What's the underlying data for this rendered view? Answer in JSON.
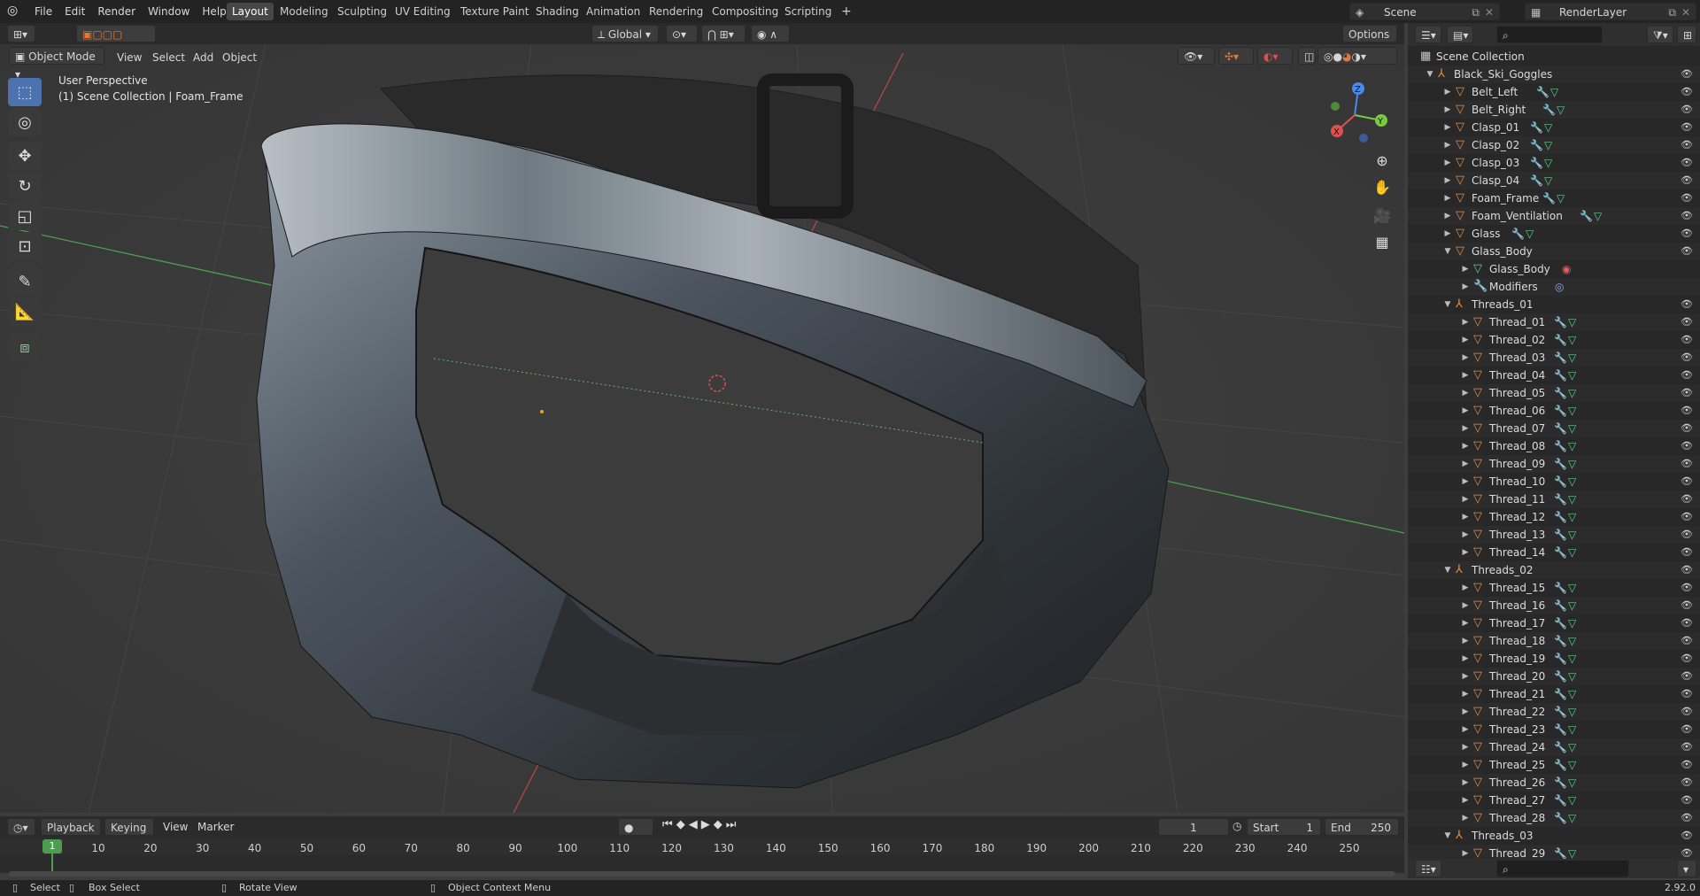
{
  "topbar": {
    "menus": [
      "File",
      "Edit",
      "Render",
      "Window",
      "Help"
    ],
    "tabs": [
      "Layout",
      "Modeling",
      "Sculpting",
      "UV Editing",
      "Texture Paint",
      "Shading",
      "Animation",
      "Rendering",
      "Compositing",
      "Scripting"
    ],
    "add_tab": "+",
    "scene_label": "Scene",
    "renderlayer_label": "RenderLayer"
  },
  "viewport_header": {
    "mode": "Object Mode",
    "menus": [
      "View",
      "Select",
      "Add",
      "Object"
    ],
    "transform": "Global",
    "options": "Options"
  },
  "viewport": {
    "perspective": "User Perspective",
    "context": "(1) Scene Collection | Foam_Frame",
    "gizmo_axes": [
      "X",
      "Y",
      "Z"
    ]
  },
  "outliner": {
    "search_placeholder": "",
    "rows": [
      {
        "label": "Scene Collection",
        "depth": 0,
        "type": "scene",
        "arrow": ""
      },
      {
        "label": "Black_Ski_Goggles",
        "depth": 1,
        "type": "empty",
        "arrow": "▼"
      },
      {
        "label": "Belt_Left",
        "depth": 2,
        "type": "mesh",
        "arrow": "▶",
        "mods": true
      },
      {
        "label": "Belt_Right",
        "depth": 2,
        "type": "mesh",
        "arrow": "▶",
        "mods": true
      },
      {
        "label": "Clasp_01",
        "depth": 2,
        "type": "mesh",
        "arrow": "▶",
        "mods": true
      },
      {
        "label": "Clasp_02",
        "depth": 2,
        "type": "mesh",
        "arrow": "▶",
        "mods": true
      },
      {
        "label": "Clasp_03",
        "depth": 2,
        "type": "mesh",
        "arrow": "▶",
        "mods": true
      },
      {
        "label": "Clasp_04",
        "depth": 2,
        "type": "mesh",
        "arrow": "▶",
        "mods": true
      },
      {
        "label": "Foam_Frame",
        "depth": 2,
        "type": "mesh",
        "arrow": "▶",
        "mods": true
      },
      {
        "label": "Foam_Ventilation",
        "depth": 2,
        "type": "mesh",
        "arrow": "▶",
        "mods": true
      },
      {
        "label": "Glass",
        "depth": 2,
        "type": "mesh",
        "arrow": "▶",
        "mods": true
      },
      {
        "label": "Glass_Body",
        "depth": 2,
        "type": "mesh",
        "arrow": "▼",
        "mods": false
      },
      {
        "label": "Glass_Body",
        "depth": 3,
        "type": "meshdata",
        "arrow": "▶",
        "mods": false,
        "material": true
      },
      {
        "label": "Modifiers",
        "depth": 3,
        "type": "modifier",
        "arrow": "▶",
        "mods": false,
        "modicon": true
      },
      {
        "label": "Threads_01",
        "depth": 2,
        "type": "empty",
        "arrow": "▼"
      },
      {
        "label": "Thread_01",
        "depth": 3,
        "type": "mesh",
        "arrow": "▶",
        "mods": true
      },
      {
        "label": "Thread_02",
        "depth": 3,
        "type": "mesh",
        "arrow": "▶",
        "mods": true
      },
      {
        "label": "Thread_03",
        "depth": 3,
        "type": "mesh",
        "arrow": "▶",
        "mods": true
      },
      {
        "label": "Thread_04",
        "depth": 3,
        "type": "mesh",
        "arrow": "▶",
        "mods": true
      },
      {
        "label": "Thread_05",
        "depth": 3,
        "type": "mesh",
        "arrow": "▶",
        "mods": true
      },
      {
        "label": "Thread_06",
        "depth": 3,
        "type": "mesh",
        "arrow": "▶",
        "mods": true
      },
      {
        "label": "Thread_07",
        "depth": 3,
        "type": "mesh",
        "arrow": "▶",
        "mods": true
      },
      {
        "label": "Thread_08",
        "depth": 3,
        "type": "mesh",
        "arrow": "▶",
        "mods": true
      },
      {
        "label": "Thread_09",
        "depth": 3,
        "type": "mesh",
        "arrow": "▶",
        "mods": true
      },
      {
        "label": "Thread_10",
        "depth": 3,
        "type": "mesh",
        "arrow": "▶",
        "mods": true
      },
      {
        "label": "Thread_11",
        "depth": 3,
        "type": "mesh",
        "arrow": "▶",
        "mods": true
      },
      {
        "label": "Thread_12",
        "depth": 3,
        "type": "mesh",
        "arrow": "▶",
        "mods": true
      },
      {
        "label": "Thread_13",
        "depth": 3,
        "type": "mesh",
        "arrow": "▶",
        "mods": true
      },
      {
        "label": "Thread_14",
        "depth": 3,
        "type": "mesh",
        "arrow": "▶",
        "mods": true
      },
      {
        "label": "Threads_02",
        "depth": 2,
        "type": "empty",
        "arrow": "▼"
      },
      {
        "label": "Thread_15",
        "depth": 3,
        "type": "mesh",
        "arrow": "▶",
        "mods": true
      },
      {
        "label": "Thread_16",
        "depth": 3,
        "type": "mesh",
        "arrow": "▶",
        "mods": true
      },
      {
        "label": "Thread_17",
        "depth": 3,
        "type": "mesh",
        "arrow": "▶",
        "mods": true
      },
      {
        "label": "Thread_18",
        "depth": 3,
        "type": "mesh",
        "arrow": "▶",
        "mods": true
      },
      {
        "label": "Thread_19",
        "depth": 3,
        "type": "mesh",
        "arrow": "▶",
        "mods": true
      },
      {
        "label": "Thread_20",
        "depth": 3,
        "type": "mesh",
        "arrow": "▶",
        "mods": true
      },
      {
        "label": "Thread_21",
        "depth": 3,
        "type": "mesh",
        "arrow": "▶",
        "mods": true
      },
      {
        "label": "Thread_22",
        "depth": 3,
        "type": "mesh",
        "arrow": "▶",
        "mods": true
      },
      {
        "label": "Thread_23",
        "depth": 3,
        "type": "mesh",
        "arrow": "▶",
        "mods": true
      },
      {
        "label": "Thread_24",
        "depth": 3,
        "type": "mesh",
        "arrow": "▶",
        "mods": true
      },
      {
        "label": "Thread_25",
        "depth": 3,
        "type": "mesh",
        "arrow": "▶",
        "mods": true
      },
      {
        "label": "Thread_26",
        "depth": 3,
        "type": "mesh",
        "arrow": "▶",
        "mods": true
      },
      {
        "label": "Thread_27",
        "depth": 3,
        "type": "mesh",
        "arrow": "▶",
        "mods": true
      },
      {
        "label": "Thread_28",
        "depth": 3,
        "type": "mesh",
        "arrow": "▶",
        "mods": true
      },
      {
        "label": "Threads_03",
        "depth": 2,
        "type": "empty",
        "arrow": "▼"
      },
      {
        "label": "Thread_29",
        "depth": 3,
        "type": "mesh",
        "arrow": "▶",
        "mods": true
      }
    ]
  },
  "timeline": {
    "menus": [
      "Playback",
      "Keying",
      "View",
      "Marker"
    ],
    "current_frame": "1",
    "start_label": "Start",
    "start": "1",
    "end_label": "End",
    "end": "250",
    "ticks": [
      "10",
      "20",
      "30",
      "40",
      "50",
      "60",
      "70",
      "80",
      "90",
      "100",
      "110",
      "120",
      "130",
      "140",
      "150",
      "160",
      "170",
      "180",
      "190",
      "200",
      "210",
      "220",
      "230",
      "240",
      "250"
    ],
    "playhead": "1"
  },
  "statusbar": {
    "select": "Select",
    "box_select": "Box Select",
    "rotate_view": "Rotate View",
    "context_menu": "Object Context Menu",
    "version": "2.92.0"
  },
  "colors": {
    "accent_tab": "#474747",
    "mesh_icon": "#e98a3a",
    "modifier_icon": "#8fa8e6",
    "meshdata_icon": "#5fcf8a",
    "active_tool": "#4c72b0"
  }
}
